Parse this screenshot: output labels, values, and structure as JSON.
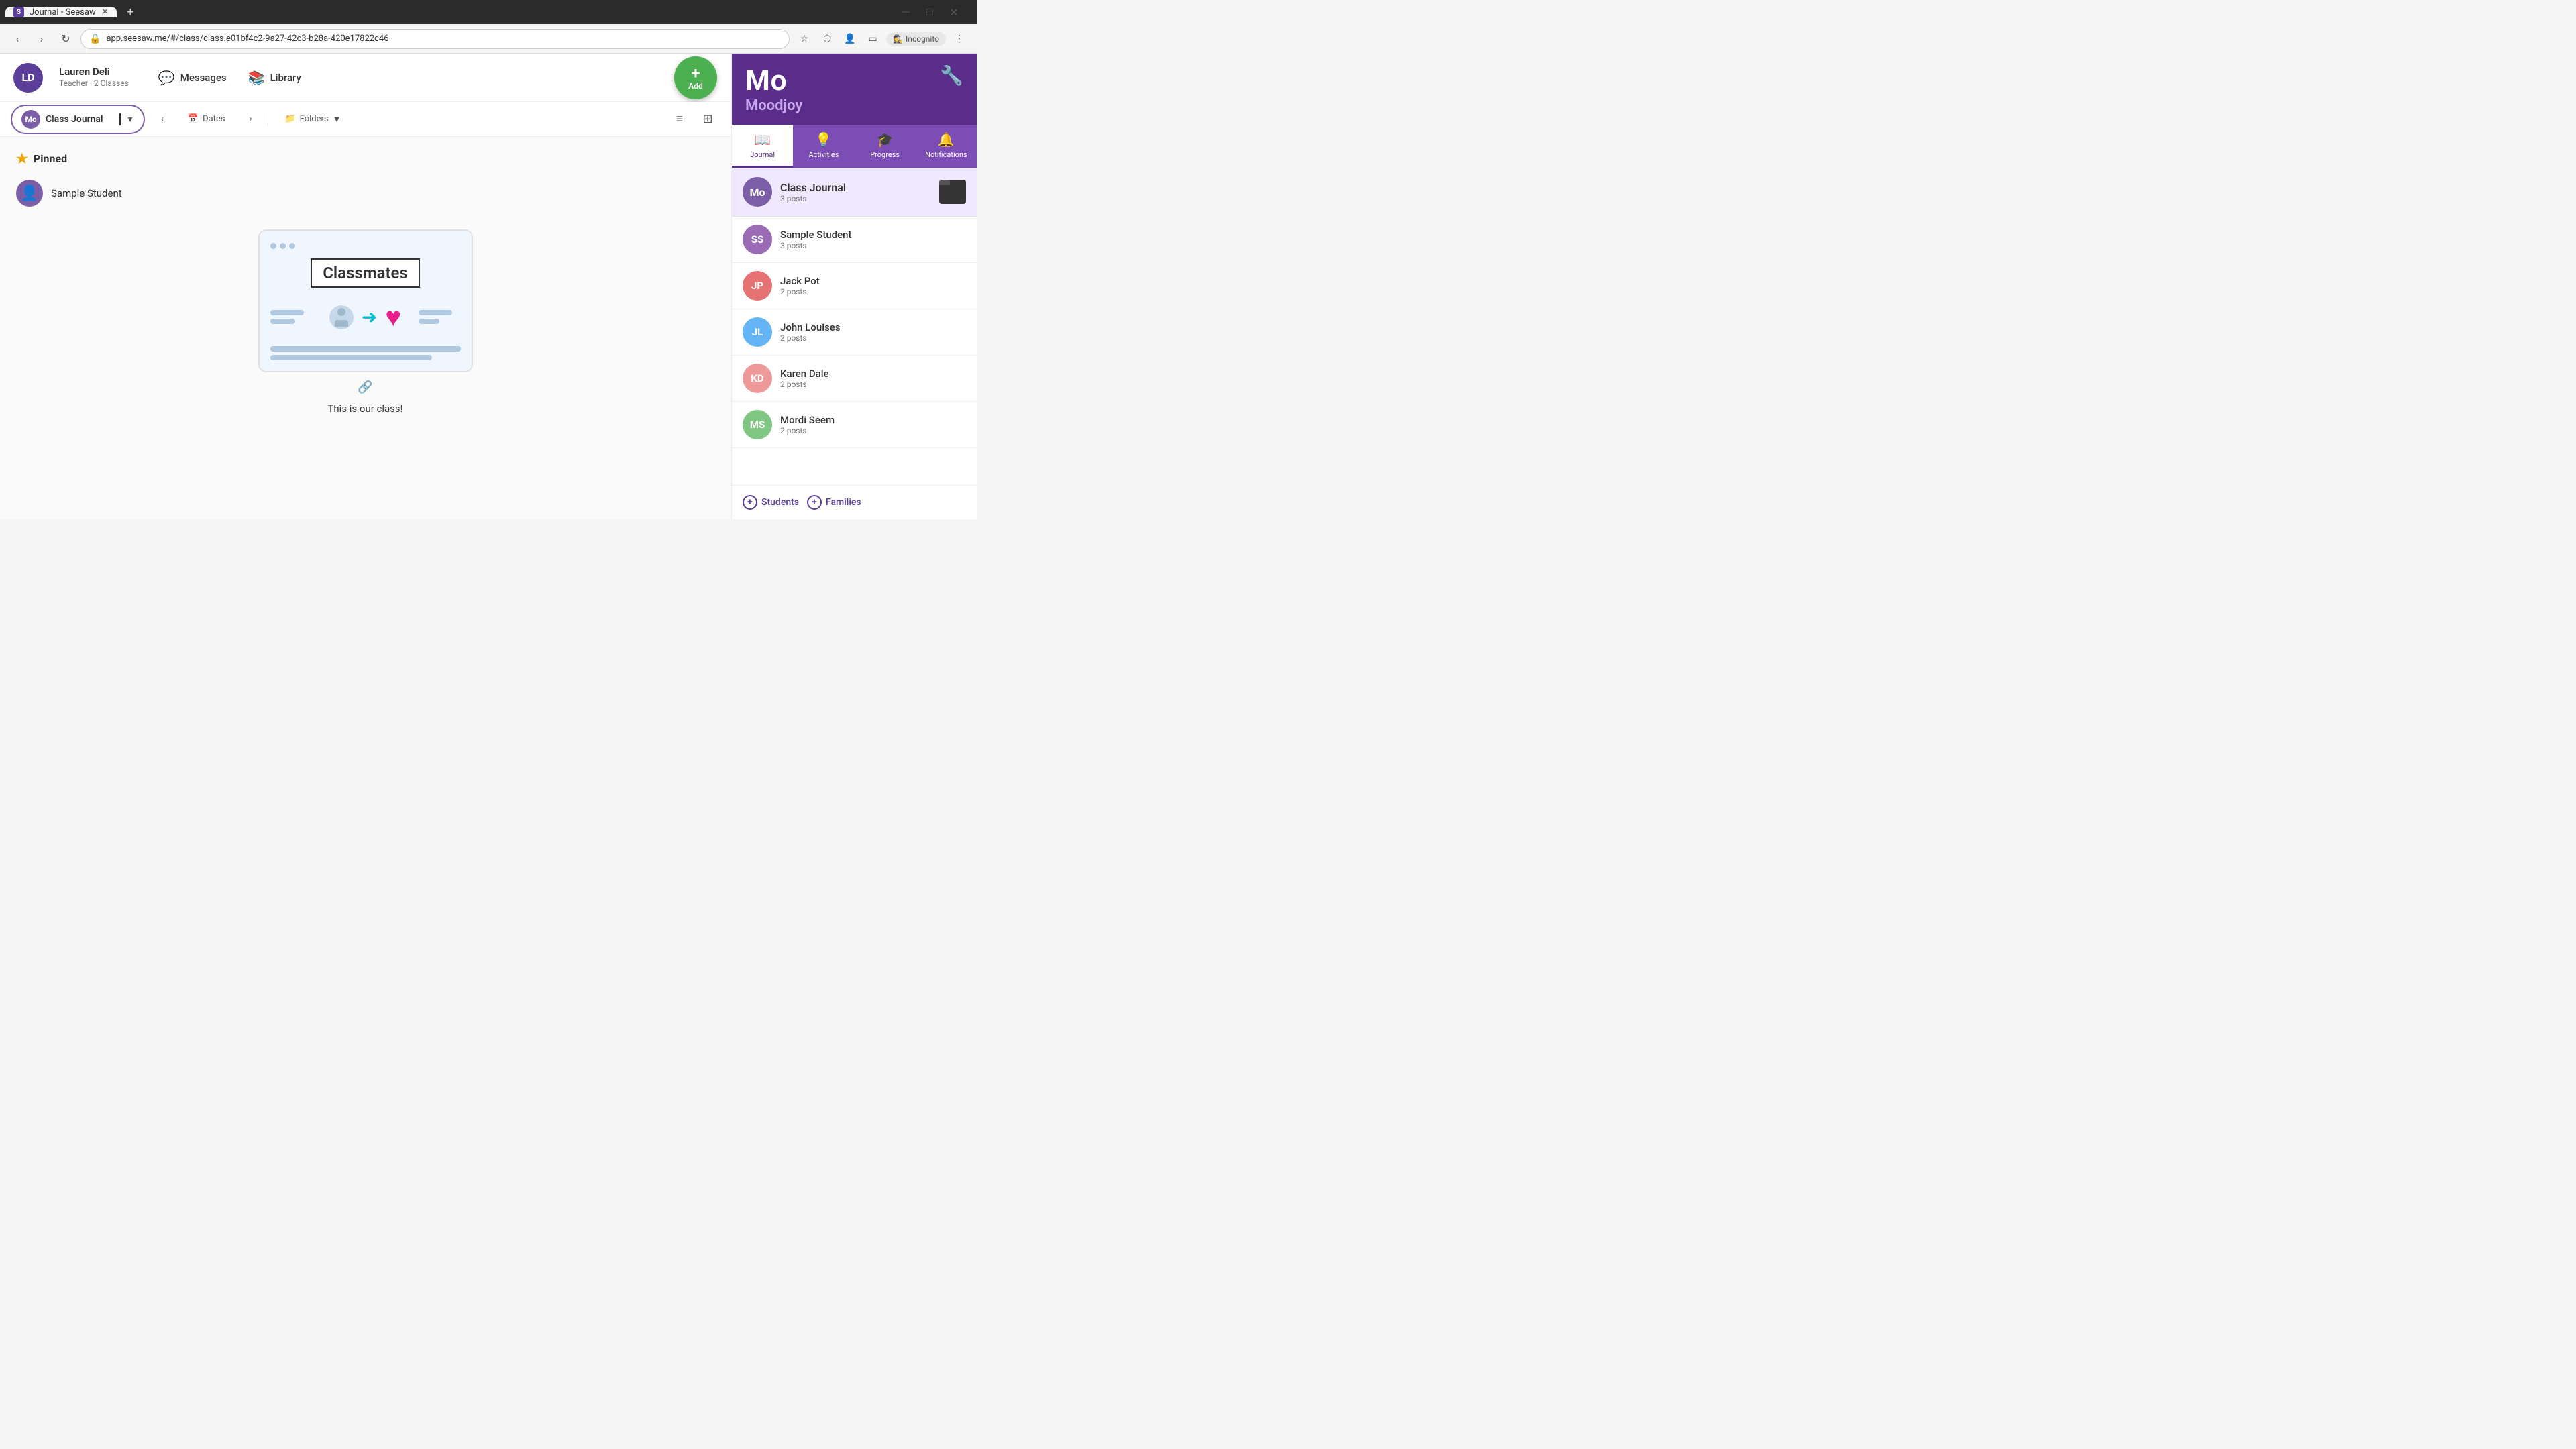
{
  "browser": {
    "tab_title": "Journal - Seesaw",
    "url": "app.seesaw.me/#/class/class.e01bf4c2-9a27-42c3-b28a-420e17822c46",
    "incognito_label": "Incognito",
    "new_tab_symbol": "+"
  },
  "header": {
    "user_initials": "LD",
    "user_name": "Lauren Deli",
    "user_role": "Teacher · 2 Classes",
    "messages_label": "Messages",
    "library_label": "Library",
    "add_label": "Add"
  },
  "toolbar": {
    "class_initial": "Mo",
    "class_name": "Class Journal",
    "dates_label": "Dates",
    "folders_label": "Folders"
  },
  "content": {
    "pinned_label": "Pinned",
    "sample_student_label": "Sample Student",
    "post_title": "Classmates",
    "post_caption": "This is our class!"
  },
  "right_panel": {
    "class_short": "Mo",
    "class_full": "Moodjoy",
    "tabs": [
      {
        "id": "journal",
        "label": "Journal",
        "icon": "📖"
      },
      {
        "id": "activities",
        "label": "Activities",
        "icon": "💡"
      },
      {
        "id": "progress",
        "label": "Progress",
        "icon": "🎓"
      },
      {
        "id": "notifications",
        "label": "Notifications",
        "icon": "🔔"
      }
    ],
    "active_tab": "journal",
    "class_journal": {
      "initial": "Mo",
      "name": "Class Journal",
      "posts": "3 posts"
    },
    "students": [
      {
        "initials": "SS",
        "name": "Sample Student",
        "posts": "3 posts",
        "color": "#9c6bb5"
      },
      {
        "initials": "JP",
        "name": "Jack Pot",
        "posts": "2 posts",
        "color": "#e57373"
      },
      {
        "initials": "JL",
        "name": "John Louises",
        "posts": "2 posts",
        "color": "#64b5f6"
      },
      {
        "initials": "KD",
        "name": "Karen Dale",
        "posts": "2 posts",
        "color": "#ef9a9a"
      },
      {
        "initials": "MS",
        "name": "Mordi Seem",
        "posts": "2 posts",
        "color": "#81c784"
      }
    ],
    "footer": {
      "students_label": "Students",
      "families_label": "Families"
    }
  }
}
